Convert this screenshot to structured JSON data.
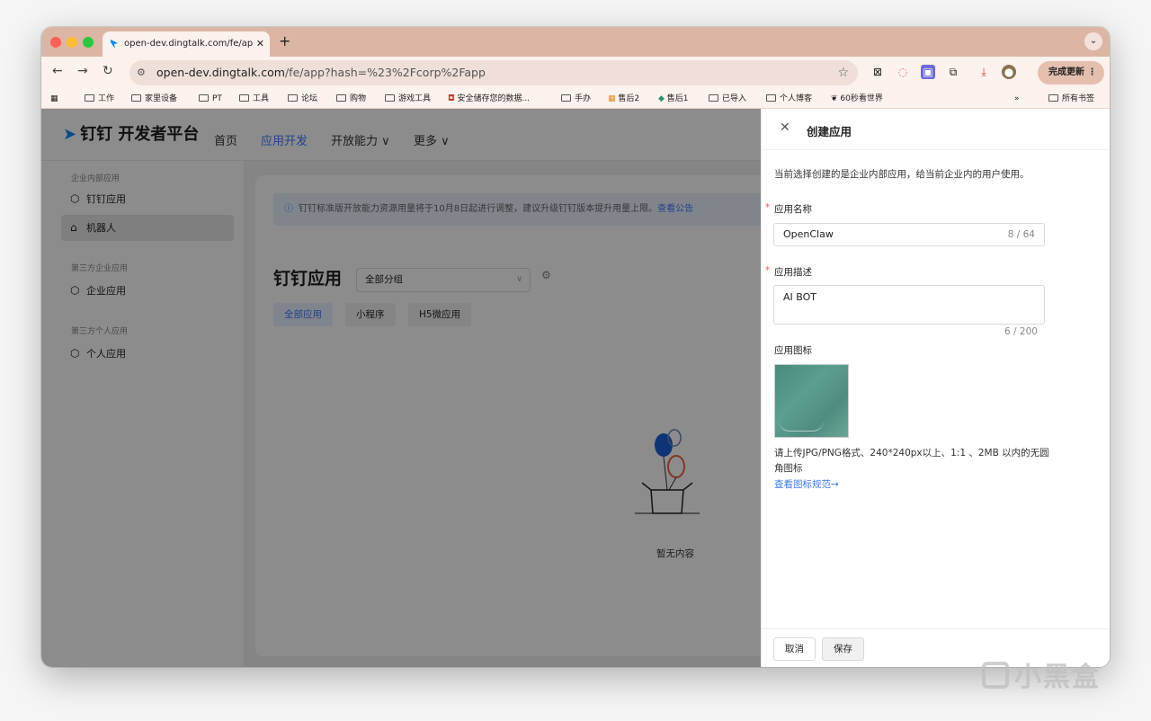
{
  "browser": {
    "tab_title": "open-dev.dingtalk.com/fe/ap",
    "new_tab": "+",
    "url_host": "open-dev.dingtalk.com",
    "url_path": "/fe/app?hash=%23%2Fcorp%2Fapp",
    "update_button": "完成更新 ⋮",
    "bookmarks": [
      "工作",
      "家里设备",
      "PT",
      "工具",
      "论坛",
      "购物",
      "游戏工具",
      "安全储存您的数据...",
      "手办",
      "售后2",
      "售后1",
      "已导入",
      "个人博客",
      "60秒看世界"
    ],
    "bookmarks_overflow": "»",
    "all_bookmarks": "所有书签"
  },
  "app": {
    "logo_text": "钉钉 开发者平台",
    "nav": [
      "首页",
      "应用开发",
      "开放能力 ∨",
      "更多 ∨"
    ]
  },
  "sidebar": {
    "section1": "企业内部应用",
    "item1": "钉钉应用",
    "item2": "机器人",
    "section2": "第三方企业应用",
    "item3": "企业应用",
    "section3": "第三方个人应用",
    "item4": "个人应用"
  },
  "main": {
    "notice": "钉钉标准版开放能力资源用量将于10月8日起进行调整，建议升级钉钉版本提升用量上限。",
    "notice_link": "查看公告",
    "title": "钉钉应用",
    "group_select": "全部分组",
    "tabs": [
      "全部应用",
      "小程序",
      "H5微应用"
    ],
    "empty": "暂无内容"
  },
  "drawer": {
    "title": "创建应用",
    "description": "当前选择创建的是企业内部应用，给当前企业内的用户使用。",
    "name_label": "应用名称",
    "name_value": "OpenClaw",
    "name_count": "8 / 64",
    "desc_label": "应用描述",
    "desc_value": "AI BOT",
    "desc_count": "6 / 200",
    "icon_label": "应用图标",
    "icon_hint": "请上传JPG/PNG格式、240*240px以上、1:1 、2MB 以内的无圆角图标",
    "icon_link": "查看图标规范→",
    "cancel": "取消",
    "save": "保存"
  },
  "watermark": "小黑盒",
  "colors": {
    "accent": "#3b7cf6",
    "tabstrip": "#dcb6a4",
    "required": "#ff4d4f"
  }
}
